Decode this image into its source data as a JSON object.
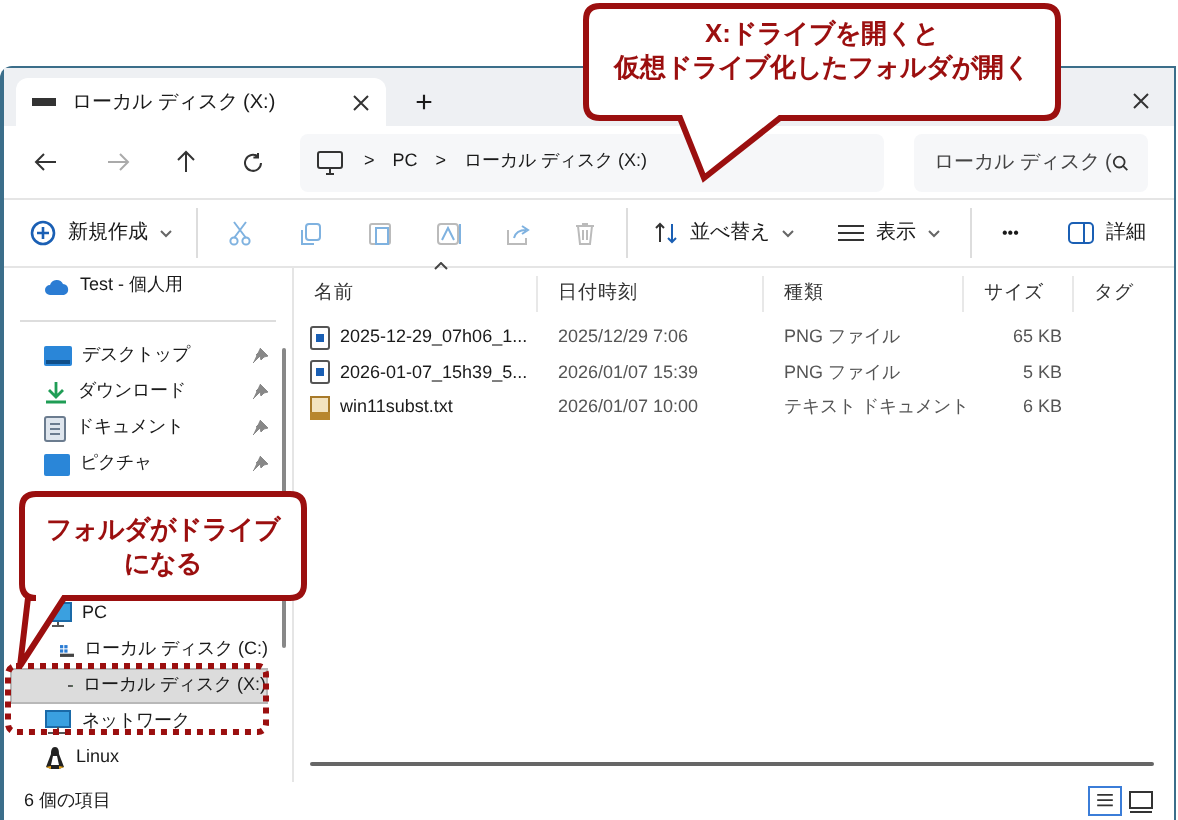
{
  "window": {
    "tab_title": "ローカル ディスク (X:)",
    "new_tab": "+"
  },
  "address": {
    "segments": [
      "PC",
      "ローカル ディスク (X:)"
    ],
    "separator": ">"
  },
  "search": {
    "placeholder": "ローカル ディスク ("
  },
  "toolbar": {
    "new": "新規作成",
    "sort": "並べ替え",
    "view": "表示",
    "more": "•••",
    "details": "詳細"
  },
  "sidebar": {
    "items": [
      {
        "kind": "cloud",
        "label": "Test - 個人用",
        "selected": false,
        "pinned": false
      },
      {
        "kind": "divider"
      },
      {
        "kind": "desktop",
        "label": "デスクトップ",
        "selected": false,
        "pinned": true
      },
      {
        "kind": "download",
        "label": "ダウンロード",
        "selected": false,
        "pinned": true
      },
      {
        "kind": "document",
        "label": "ドキュメント",
        "selected": false,
        "pinned": true
      },
      {
        "kind": "picture",
        "label": "ピクチャ",
        "selected": false,
        "pinned": true
      },
      {
        "kind": "gap"
      },
      {
        "kind": "pc",
        "label": "PC",
        "selected": false,
        "pinned": false
      },
      {
        "kind": "drive_c",
        "label": "ローカル ディスク (C:)",
        "selected": false,
        "pinned": false
      },
      {
        "kind": "drive",
        "label": "ローカル ディスク (X:)",
        "selected": true,
        "pinned": false
      },
      {
        "kind": "network",
        "label": "ネットワーク",
        "selected": false,
        "pinned": false
      },
      {
        "kind": "linux",
        "label": "Linux",
        "selected": false,
        "pinned": false
      }
    ]
  },
  "table": {
    "columns": [
      "名前",
      "日付時刻",
      "種類",
      "サイズ",
      "タグ"
    ],
    "rows": [
      {
        "kind": "png",
        "name": "2025-12-29_07h06_1...",
        "date": "2025/12/29 7:06",
        "type": "PNG ファイル",
        "size": "65 KB"
      },
      {
        "kind": "png",
        "name": "2026-01-07_15h39_5...",
        "date": "2026/01/07 15:39",
        "type": "PNG ファイル",
        "size": "5 KB"
      },
      {
        "kind": "txt",
        "name": "win11subst.txt",
        "date": "2026/01/07 10:00",
        "type": "テキスト ドキュメント",
        "size": "6 KB"
      }
    ]
  },
  "status_bar": {
    "count": "6 個の項目"
  },
  "callouts": [
    {
      "lines": [
        "X:ドライブを開くと",
        "仮想ドライブ化したフォルダが開く"
      ]
    },
    {
      "lines": [
        "フォルダがドライブ",
        "になる"
      ]
    }
  ]
}
